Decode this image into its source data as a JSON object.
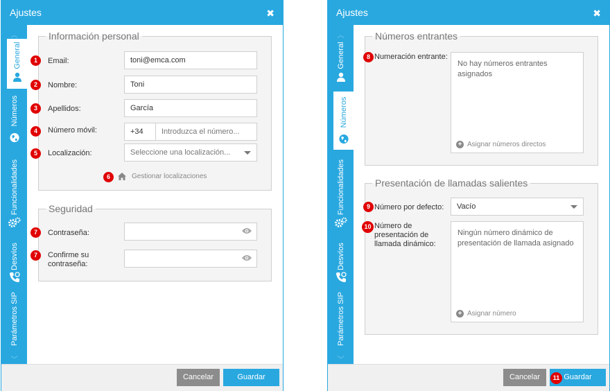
{
  "dialog_title": "Ajustes",
  "close_glyph": "✖",
  "sidebar_tabs": {
    "general": "General",
    "numeros": "Números",
    "funcionalidades": "Funcionalidades",
    "desvios": "Desvíos",
    "parametros_sip": "Parámetros SIP"
  },
  "left": {
    "personal": {
      "legend": "Información personal",
      "email_label": "Email:",
      "email_value": "toni@emca.com",
      "nombre_label": "Nombre:",
      "nombre_value": "Toni",
      "apellidos_label": "Apellidos:",
      "apellidos_value": "García",
      "movil_label": "Número móvil:",
      "movil_prefix": "+34",
      "movil_placeholder": "Introduzca el número...",
      "localizacion_label": "Localización:",
      "localizacion_placeholder": "Seleccione una localización...",
      "gestionar_link": "Gestionar localizaciones"
    },
    "seguridad": {
      "legend": "Seguridad",
      "contrasena_label": "Contraseña:",
      "confirme_label": "Confirme su contraseña:"
    }
  },
  "right": {
    "entrantes": {
      "legend": "Números entrantes",
      "numeracion_label": "Numeración entrante:",
      "empty_text": "No hay números entrantes asignados",
      "assign_link": "Asignar números directos"
    },
    "presentacion": {
      "legend": "Presentación de llamadas salientes",
      "defecto_label": "Número por defecto:",
      "defecto_value": "Vacío",
      "dinamico_label": "Número de presentación de llamada dinámico:",
      "dinamico_empty": "Ningún número dinámico de presentación de llamada asignado",
      "assign_link": "Asignar número"
    }
  },
  "buttons": {
    "cancel": "Cancelar",
    "save": "Guardar"
  },
  "badges": {
    "b1": "1",
    "b2": "2",
    "b3": "3",
    "b4": "4",
    "b5": "5",
    "b6": "6",
    "b7": "7",
    "b8": "8",
    "b9": "9",
    "b10": "10",
    "b11": "11"
  },
  "colors": {
    "accent": "#29a8e0",
    "badge": "#e00000",
    "cancel_button": "#8c8c8c"
  },
  "icons": {
    "close": "close-icon",
    "user": "user-icon",
    "globe": "globe-icon",
    "gears": "gears-icon",
    "phone": "phone-forward-icon",
    "home": "home-icon",
    "eye": "eye-icon",
    "plus": "plus-circle-icon"
  }
}
